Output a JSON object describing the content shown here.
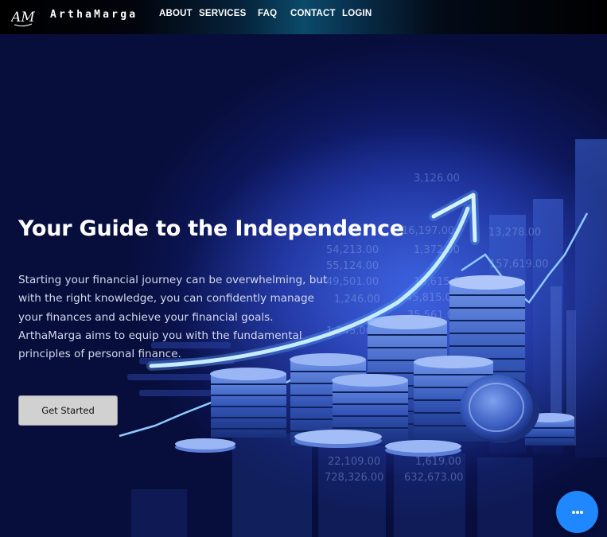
{
  "brand": {
    "name": "ArthaMarga",
    "logo_text": "AM"
  },
  "nav": {
    "items": [
      "ABOUT",
      "SERVICES",
      "FAQ",
      "CONTACT",
      "LOGIN"
    ]
  },
  "hero": {
    "title": "Your Guide to the Independence",
    "text": "Starting your financial journey can be overwhelming, but with the right knowledge, you can confidently manage your finances and achieve your financial goals. ArthaMarga aims to equip you with the fundamental principles of personal finance.",
    "cta_label": "Get Started",
    "background_numbers": [
      "3,126.00",
      "54,213.00",
      "55,124.00",
      "49,501.00",
      "1,246.00",
      "16,197.00",
      "1,372.00",
      "10,615.00",
      "45,815.00",
      "35,561.00",
      "157,619.00",
      "13,278.00",
      "1,245.00",
      "22,109.00",
      "1,619.00",
      "728,326.00",
      "632,673.00"
    ]
  },
  "chat": {
    "icon": "chat-dots-icon"
  },
  "colors": {
    "hero_bg": "#0c1658",
    "accent": "#1f87ff",
    "arrow": "#aee0ff",
    "cta_bg": "#d1d1d1"
  }
}
